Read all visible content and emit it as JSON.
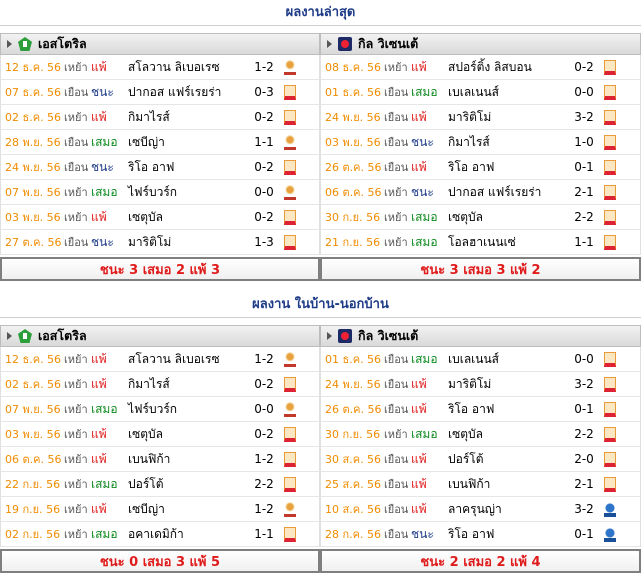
{
  "sections": [
    {
      "title": "ผลงานล่าสุด",
      "left": {
        "team": "เอสโตริล",
        "rows": [
          {
            "date": "12 ธ.ค. 56",
            "ha": "เหย้า",
            "result": "แพ้",
            "type": "lose",
            "opponent": "สโลวาน ลิเบอเรซ",
            "score": "1-2",
            "icon": "ucl"
          },
          {
            "date": "07 ธ.ค. 56",
            "ha": "เยือน",
            "result": "ชนะ",
            "type": "win",
            "opponent": "ปากอส แฟร์เรยร่า",
            "score": "0-3",
            "icon": "league"
          },
          {
            "date": "02 ธ.ค. 56",
            "ha": "เหย้า",
            "result": "แพ้",
            "type": "lose",
            "opponent": "กิมาไรส์",
            "score": "0-2",
            "icon": "league"
          },
          {
            "date": "28 พ.ย. 56",
            "ha": "เยือน",
            "result": "เสมอ",
            "type": "draw",
            "opponent": "เซบีญ่า",
            "score": "1-1",
            "icon": "ucl"
          },
          {
            "date": "24 พ.ย. 56",
            "ha": "เยือน",
            "result": "ชนะ",
            "type": "win",
            "opponent": "ริโอ อาฟ",
            "score": "0-2",
            "icon": "league"
          },
          {
            "date": "07 พ.ย. 56",
            "ha": "เหย้า",
            "result": "เสมอ",
            "type": "draw",
            "opponent": "ไฟร์บวร์ก",
            "score": "0-0",
            "icon": "ucl"
          },
          {
            "date": "03 พ.ย. 56",
            "ha": "เหย้า",
            "result": "แพ้",
            "type": "lose",
            "opponent": "เซตุบัล",
            "score": "0-2",
            "icon": "league"
          },
          {
            "date": "27 ต.ค. 56",
            "ha": "เยือน",
            "result": "ชนะ",
            "type": "win",
            "opponent": "มาริติโม่",
            "score": "1-3",
            "icon": "league"
          }
        ],
        "summary": "ชนะ 3 เสมอ 2 แพ้ 3"
      },
      "right": {
        "team": "กิล วิเซนเต้",
        "rows": [
          {
            "date": "08 ธ.ค. 56",
            "ha": "เหย้า",
            "result": "แพ้",
            "type": "lose",
            "opponent": "สปอร์ติ้ง ลิสบอน",
            "score": "0-2",
            "icon": "league"
          },
          {
            "date": "01 ธ.ค. 56",
            "ha": "เยือน",
            "result": "เสมอ",
            "type": "draw",
            "opponent": "เบเลเนนส์",
            "score": "0-0",
            "icon": "league"
          },
          {
            "date": "24 พ.ย. 56",
            "ha": "เยือน",
            "result": "แพ้",
            "type": "lose",
            "opponent": "มาริติโม่",
            "score": "3-2",
            "icon": "league"
          },
          {
            "date": "03 พ.ย. 56",
            "ha": "เยือน",
            "result": "ชนะ",
            "type": "win",
            "opponent": "กิมาไรส์",
            "score": "1-0",
            "icon": "league"
          },
          {
            "date": "26 ต.ค. 56",
            "ha": "เยือน",
            "result": "แพ้",
            "type": "lose",
            "opponent": "ริโอ อาฟ",
            "score": "0-1",
            "icon": "league"
          },
          {
            "date": "06 ต.ค. 56",
            "ha": "เหย้า",
            "result": "ชนะ",
            "type": "win",
            "opponent": "ปากอส แฟร์เรยร่า",
            "score": "2-1",
            "icon": "league"
          },
          {
            "date": "30 ก.ย. 56",
            "ha": "เหย้า",
            "result": "เสมอ",
            "type": "draw",
            "opponent": "เซตุบัล",
            "score": "2-2",
            "icon": "league"
          },
          {
            "date": "21 ก.ย. 56",
            "ha": "เหย้า",
            "result": "เสมอ",
            "type": "draw",
            "opponent": "โอลฮาเนนเซ่",
            "score": "1-1",
            "icon": "league"
          }
        ],
        "summary": "ชนะ 3 เสมอ 3 แพ้ 2"
      }
    },
    {
      "title": "ผลงาน ในบ้าน-นอกบ้าน",
      "left": {
        "team": "เอสโตริล",
        "rows": [
          {
            "date": "12 ธ.ค. 56",
            "ha": "เหย้า",
            "result": "แพ้",
            "type": "lose",
            "opponent": "สโลวาน ลิเบอเรซ",
            "score": "1-2",
            "icon": "ucl"
          },
          {
            "date": "02 ธ.ค. 56",
            "ha": "เหย้า",
            "result": "แพ้",
            "type": "lose",
            "opponent": "กิมาไรส์",
            "score": "0-2",
            "icon": "league"
          },
          {
            "date": "07 พ.ย. 56",
            "ha": "เหย้า",
            "result": "เสมอ",
            "type": "draw",
            "opponent": "ไฟร์บวร์ก",
            "score": "0-0",
            "icon": "ucl"
          },
          {
            "date": "03 พ.ย. 56",
            "ha": "เหย้า",
            "result": "แพ้",
            "type": "lose",
            "opponent": "เซตุบัล",
            "score": "0-2",
            "icon": "league"
          },
          {
            "date": "06 ต.ค. 56",
            "ha": "เหย้า",
            "result": "แพ้",
            "type": "lose",
            "opponent": "เบนฟิก้า",
            "score": "1-2",
            "icon": "league"
          },
          {
            "date": "22 ก.ย. 56",
            "ha": "เหย้า",
            "result": "เสมอ",
            "type": "draw",
            "opponent": "ปอร์โต้",
            "score": "2-2",
            "icon": "league"
          },
          {
            "date": "19 ก.ย. 56",
            "ha": "เหย้า",
            "result": "แพ้",
            "type": "lose",
            "opponent": "เซบีญ่า",
            "score": "1-2",
            "icon": "ucl"
          },
          {
            "date": "02 ก.ย. 56",
            "ha": "เหย้า",
            "result": "เสมอ",
            "type": "draw",
            "opponent": "อคาเดมิก้า",
            "score": "1-1",
            "icon": "league"
          }
        ],
        "summary": "ชนะ 0 เสมอ 3 แพ้ 5"
      },
      "right": {
        "team": "กิล วิเซนเต้",
        "rows": [
          {
            "date": "01 ธ.ค. 56",
            "ha": "เยือน",
            "result": "เสมอ",
            "type": "draw",
            "opponent": "เบเลเนนส์",
            "score": "0-0",
            "icon": "league"
          },
          {
            "date": "24 พ.ย. 56",
            "ha": "เยือน",
            "result": "แพ้",
            "type": "lose",
            "opponent": "มาริติโม่",
            "score": "3-2",
            "icon": "league"
          },
          {
            "date": "26 ต.ค. 56",
            "ha": "เยือน",
            "result": "แพ้",
            "type": "lose",
            "opponent": "ริโอ อาฟ",
            "score": "0-1",
            "icon": "league"
          },
          {
            "date": "30 ก.ย. 56",
            "ha": "เหย้า",
            "result": "เสมอ",
            "type": "draw",
            "opponent": "เซตุบัล",
            "score": "2-2",
            "icon": "league"
          },
          {
            "date": "30 ส.ค. 56",
            "ha": "เยือน",
            "result": "แพ้",
            "type": "lose",
            "opponent": "ปอร์โต้",
            "score": "2-0",
            "icon": "league"
          },
          {
            "date": "25 ส.ค. 56",
            "ha": "เยือน",
            "result": "แพ้",
            "type": "lose",
            "opponent": "เบนฟิก้า",
            "score": "2-1",
            "icon": "league"
          },
          {
            "date": "10 ส.ค. 56",
            "ha": "เยือน",
            "result": "แพ้",
            "type": "lose",
            "opponent": "ลาครุนญ่า",
            "score": "3-2",
            "icon": "fifa"
          },
          {
            "date": "28 ก.ค. 56",
            "ha": "เยือน",
            "result": "ชนะ",
            "type": "win",
            "opponent": "ริโอ อาฟ",
            "score": "0-1",
            "icon": "fifa"
          }
        ],
        "summary": "ชนะ 2 เสมอ 2 แพ้ 4"
      }
    }
  ]
}
